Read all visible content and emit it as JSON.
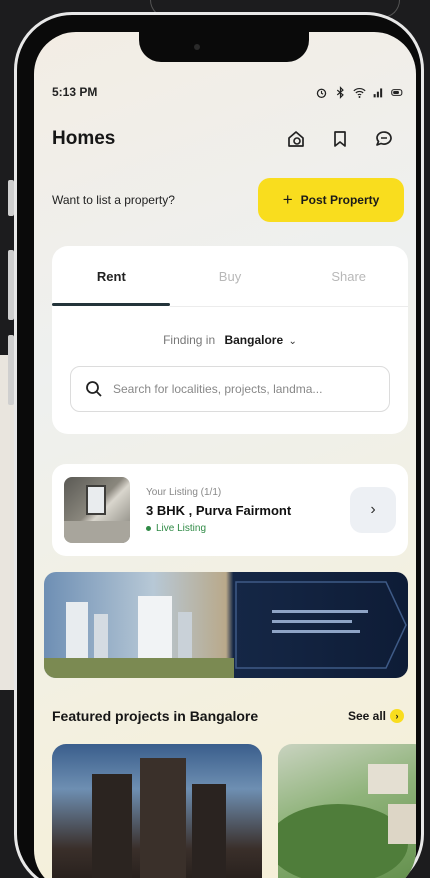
{
  "status_bar": {
    "time": "5:13 PM"
  },
  "header": {
    "title": "Homes",
    "icons": [
      "home-alert-icon",
      "bookmark-icon",
      "chat-icon"
    ]
  },
  "post_row": {
    "question": "Want to list a property?",
    "button_label": "Post Property"
  },
  "search_card": {
    "tabs": [
      {
        "label": "Rent",
        "active": true
      },
      {
        "label": "Buy",
        "active": false
      },
      {
        "label": "Share",
        "active": false
      }
    ],
    "finding_label": "Finding in",
    "city": "Bangalore",
    "search_placeholder": "Search for localities, projects, landma..."
  },
  "listing": {
    "label": "Your Listing (1/1)",
    "title": "3 BHK , Purva Fairmont",
    "status": "Live Listing"
  },
  "featured": {
    "title": "Featured projects in Bangalore",
    "see_all": "See all"
  },
  "colors": {
    "accent_yellow": "#f9dd1e",
    "tab_underline": "#23343a",
    "live_green": "#2f8a45"
  }
}
